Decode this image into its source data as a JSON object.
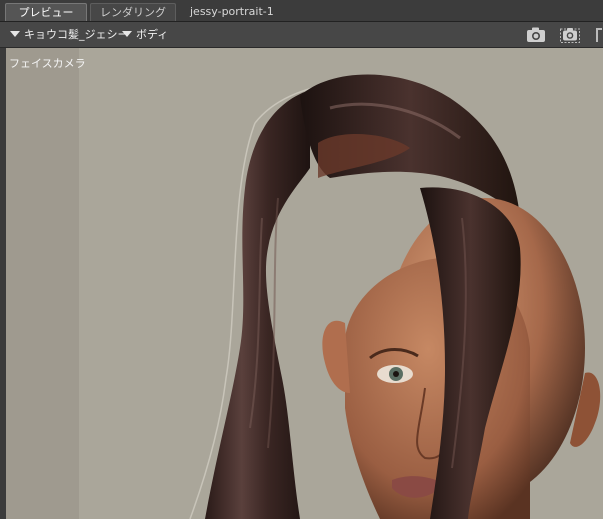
{
  "tabs": [
    {
      "label": "プレビュー"
    },
    {
      "label": "レンダリング"
    },
    {
      "label": "jessy-portrait-1"
    }
  ],
  "toolbar": {
    "figure_dropdown": "キョウコ髪_ジェシー",
    "body_dropdown": "ボディ",
    "icons": [
      "camera-icon",
      "camera-select-icon"
    ]
  },
  "viewport": {
    "camera_label": "フェイスカメラ"
  },
  "colors": {
    "viewport_bg": "#aaa69a",
    "side_panel": "#9f9a8f",
    "hair": "#3b2522",
    "skin": "#b07352"
  }
}
